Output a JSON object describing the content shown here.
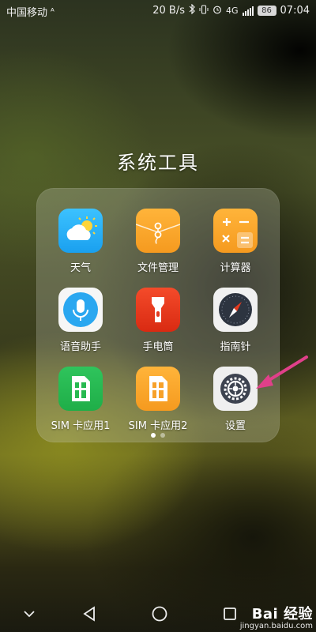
{
  "status_bar": {
    "carrier": "中国移动",
    "carrier_badge": "ᴬ",
    "network_speed": "20 B/s",
    "network_type": "4G",
    "battery": "86",
    "time": "07:04",
    "icons": [
      "bluetooth-icon",
      "vibrate-icon",
      "alarm-icon",
      "signal-icon",
      "battery-icon"
    ]
  },
  "folder": {
    "title": "系统工具",
    "apps": [
      {
        "label": "天气",
        "icon": "weather-icon"
      },
      {
        "label": "文件管理",
        "icon": "file-manager-icon"
      },
      {
        "label": "计算器",
        "icon": "calculator-icon"
      },
      {
        "label": "语音助手",
        "icon": "voice-assistant-icon"
      },
      {
        "label": "手电筒",
        "icon": "flashlight-icon"
      },
      {
        "label": "指南针",
        "icon": "compass-icon"
      },
      {
        "label": "SIM 卡应用1",
        "icon": "sim-app-icon"
      },
      {
        "label": "SIM 卡应用2",
        "icon": "sim-app-icon"
      },
      {
        "label": "设置",
        "icon": "settings-icon"
      }
    ],
    "page_count": 2,
    "current_page": 1
  },
  "annotation": {
    "color": "#e0408a"
  },
  "nav_bar": {
    "icons": [
      "chevron-down-icon",
      "back-icon",
      "home-icon",
      "recents-icon"
    ]
  },
  "watermark": {
    "brand": "Bai 经验",
    "url": "jingyan.baidu.com"
  },
  "colors": {
    "orange": "#f7a12a",
    "blue": "#26b0f5",
    "green": "#27b950",
    "red": "#e93a1d"
  }
}
